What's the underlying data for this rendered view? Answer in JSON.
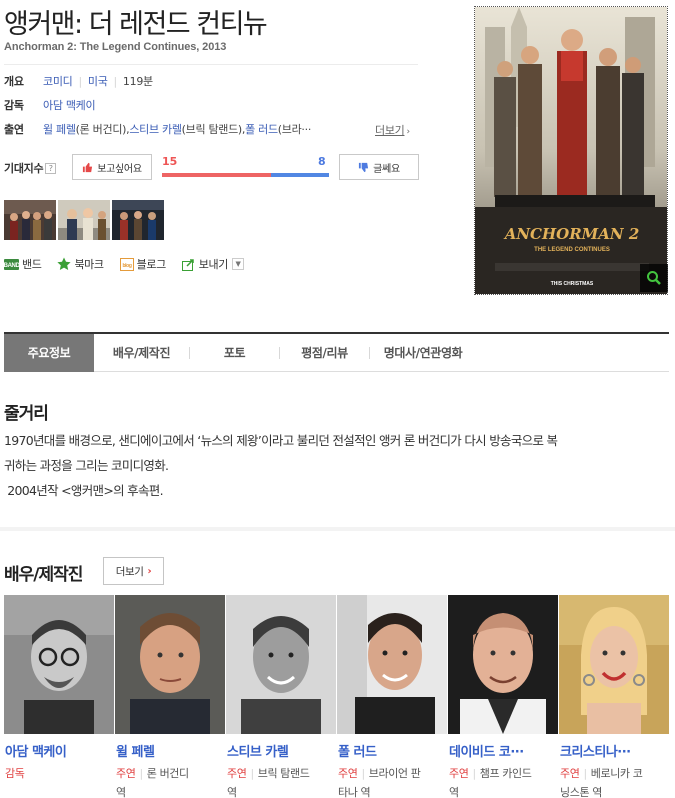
{
  "movie": {
    "title": "앵커맨: 더 레전드 컨티뉴",
    "subtitle": "Anchorman 2: The Legend Continues, 2013"
  },
  "info": {
    "overview_label": "개요",
    "genre": "코미디",
    "country": "미국",
    "runtime": "119분",
    "director_label": "감독",
    "director": "아담 맥케이",
    "cast_label": "출연",
    "cast_1": "윌 페렐",
    "cast_1_role": "(론 버건디)",
    "cast_2": "스티브 카렐",
    "cast_2_role": "(브릭 탐랜드)",
    "cast_3": "폴 러드",
    "cast_3_role": "(브라···",
    "more": "더보기"
  },
  "expectation": {
    "label": "기대지수",
    "help": "?",
    "want_label": "보고싶어요",
    "no_label": "글쎄요",
    "want_count": "15",
    "no_count": "8",
    "want_ratio": 0.652
  },
  "share": {
    "band": "밴드",
    "bookmark": "북마크",
    "blog": "블로그",
    "send": "보내기"
  },
  "poster": {
    "title_text": "ANCHORMAN 2",
    "subtitle_text": "THE LEGEND CONTINUES",
    "release_text": "THIS CHRISTMAS"
  },
  "tabs": [
    {
      "label": "주요정보"
    },
    {
      "label": "배우/제작진"
    },
    {
      "label": "포토"
    },
    {
      "label": "평점/리뷰"
    },
    {
      "label": "명대사/연관영화"
    }
  ],
  "synopsis": {
    "heading": "줄거리",
    "line1": "1970년대를 배경으로, 샌디에이고에서 ‘뉴스의 제왕’이라고 불리던 전설적인 앵커 론 버건디가 다시 방송국으로 복",
    "line2": "귀하는 과정을 그리는 코미디영화.",
    "line3": " 2004년작 <앵커맨>의 후속편."
  },
  "cast_section": {
    "heading": "배우/제작진",
    "more": "더보기",
    "people": [
      {
        "name": "아담 맥케이",
        "role": "감독",
        "char1": "",
        "char2": ""
      },
      {
        "name": "윌 페렐",
        "role": "주연",
        "char1": "론 버건디",
        "char2": "역"
      },
      {
        "name": "스티브 카렐",
        "role": "주연",
        "char1": "브릭 탐랜드",
        "char2": "역"
      },
      {
        "name": "폴 러드",
        "role": "주연",
        "char1": "브라이언 판",
        "char2": "타나 역"
      },
      {
        "name": "데이비드 코···",
        "role": "주연",
        "char1": "챔프 카인드",
        "char2": "역"
      },
      {
        "name": "크리스티나···",
        "role": "주연",
        "char1": "베로니카 코",
        "char2": "닝스톤 역"
      }
    ]
  },
  "colors": {
    "link": "#3a5cb5",
    "want": "#ee6464",
    "no": "#5187e3",
    "role": "#e04040",
    "tab_active": "#777777"
  }
}
